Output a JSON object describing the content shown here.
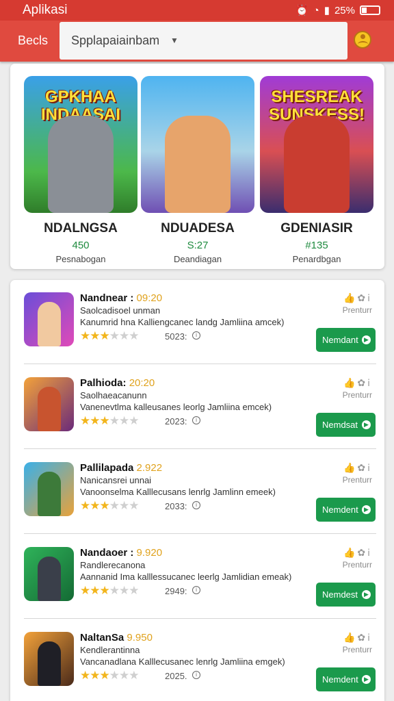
{
  "status_bar": {
    "app_name": "Aplikasi",
    "battery": "25%"
  },
  "toolbar": {
    "label": "Becls",
    "search_value": "Spplapaiainbam",
    "colors": {
      "bar": "#e04a3f",
      "status": "#d63a31"
    }
  },
  "featured": [
    {
      "title": "NDALNGSA",
      "price": "450",
      "subtitle": "Pesnabogan",
      "logo_text": "GPKHAA INDAASAI",
      "icon": "robot-character"
    },
    {
      "title": "NDUADESA",
      "price": "S:27",
      "subtitle": "Deandiagan",
      "logo_text": "",
      "icon": "hero-character"
    },
    {
      "title": "GDENIASIR",
      "price": "#135",
      "subtitle": "Penardbgan",
      "logo_text": "SHESREAK SUNSKESS!",
      "icon": "team-characters"
    }
  ],
  "list": [
    {
      "title": "Nandnear :",
      "time": "09:20",
      "subtitle": "Saolcadisoel unman",
      "description": "Kanumrid hna Kalliengcanec landg Jamliina amcek)",
      "rating": 3.5,
      "count": "5023:",
      "premium": "Prenturr",
      "button": "Nemdant"
    },
    {
      "title": "Palhioda:",
      "time": "20:20",
      "subtitle": "Saolhaeacanunn",
      "description": "Vanenevtlma kalleusanes leorlg Jamliina emcek)",
      "rating": 3.5,
      "count": "2023:",
      "premium": "Prenturr",
      "button": "Nemdsat"
    },
    {
      "title": "Pallilapada",
      "time": "2.922",
      "subtitle": "Nanicansrei unnai",
      "description": "Vanoonselma Kalllecusans lenrlg Jamlinn emeek)",
      "rating": 3.5,
      "count": "2033:",
      "premium": "Prenturr",
      "button": "Nemdent"
    },
    {
      "title": "Nandaoer :",
      "time": "9.920",
      "subtitle": "Randlerecanona",
      "description": "Aannanid Ima kalllessucanec leerlg Jamlidian emeak)",
      "rating": 3.5,
      "count": "2949:",
      "premium": "Prenturr",
      "button": "Nemdest"
    },
    {
      "title": "NaltanSa",
      "time": "9.950",
      "subtitle": "Kendlerantinna",
      "description": "Vancanadlana Kalllecusanec lenrlg Jamliina emgek)",
      "rating": 3.5,
      "count": "2025.",
      "premium": "Prenturr",
      "button": "Nemdent"
    }
  ]
}
